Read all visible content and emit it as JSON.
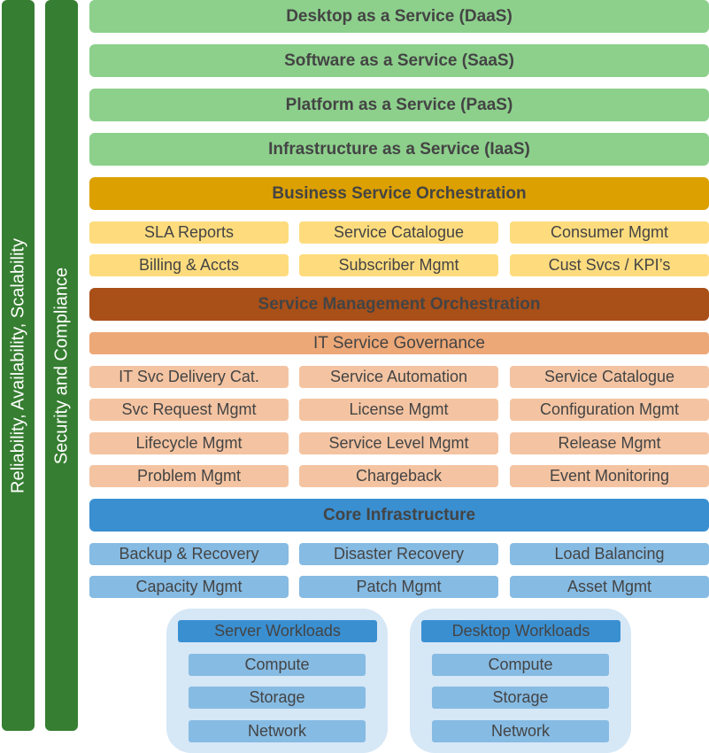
{
  "pillars": [
    {
      "label": "Reliability, Availability, Scalability"
    },
    {
      "label": "Security and Compliance"
    }
  ],
  "service_models": [
    {
      "label": "Desktop as a Service (DaaS)"
    },
    {
      "label": "Software as a Service (SaaS)"
    },
    {
      "label": "Platform as a Service (PaaS)"
    },
    {
      "label": "Infrastructure as a Service (IaaS)"
    }
  ],
  "business_orchestration": {
    "title": "Business Service Orchestration",
    "items": [
      "SLA Reports",
      "Service Catalogue",
      "Consumer Mgmt",
      "Billing & Accts",
      "Subscriber Mgmt",
      "Cust Svcs / KPI’s"
    ]
  },
  "service_mgmt_orchestration": {
    "title": "Service Management Orchestration",
    "governance": "IT Service Governance",
    "items": [
      "IT Svc Delivery Cat.",
      "Service Automation",
      "Service Catalogue",
      "Svc Request Mgmt",
      "License Mgmt",
      "Configuration Mgmt",
      "Lifecycle Mgmt",
      "Service Level Mgmt",
      "Release Mgmt",
      "Problem Mgmt",
      "Chargeback",
      "Event Monitoring"
    ]
  },
  "core_infrastructure": {
    "title": "Core Infrastructure",
    "items": [
      "Backup & Recovery",
      "Disaster Recovery",
      "Load Balancing",
      "Capacity Mgmt",
      "Patch Mgmt",
      "Asset Mgmt"
    ]
  },
  "workloads": [
    {
      "title": "Server Workloads",
      "items": [
        "Compute",
        "Storage",
        "Network"
      ]
    },
    {
      "title": "Desktop Workloads",
      "items": [
        "Compute",
        "Storage",
        "Network"
      ]
    }
  ],
  "colors": {
    "pillar": "#367e31",
    "service_model": "#8dd08c",
    "business_orchestration": "#dca000",
    "business_item": "#fedc7e",
    "service_mgmt_orchestration": "#a94f18",
    "governance": "#eda877",
    "service_mgmt_item": "#f4c4a2",
    "core_infrastructure": "#3a8fd1",
    "core_item": "#86bbe3",
    "workload_container": "#d6e7f6"
  }
}
